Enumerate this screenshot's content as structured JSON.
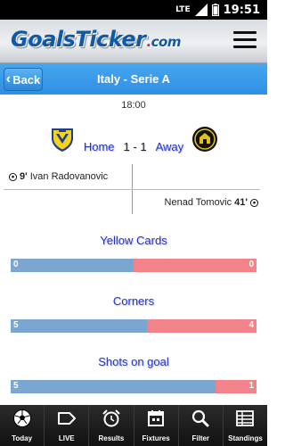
{
  "status_bar": {
    "network": "LTE",
    "time": "19:51"
  },
  "header": {
    "logo_goals": "Goals",
    "logo_ticker": "Ticker",
    "logo_dot": ".",
    "logo_com": "com",
    "menu_icon": "hamburger-menu-icon"
  },
  "nav": {
    "back_label": "Back",
    "title": "Italy - Serie A"
  },
  "match": {
    "kickoff_time": "18:00",
    "home_label": "Home",
    "score": "1 - 1",
    "away_label": "Away"
  },
  "events": [
    {
      "side": "home",
      "minute": "9'",
      "player": "Ivan Radovanovic"
    },
    {
      "side": "away",
      "minute": "41'",
      "player": "Nenad Tomovic"
    }
  ],
  "stats": [
    {
      "title": "Yellow Cards",
      "home": "0",
      "away": "0",
      "home_share": 0.5
    },
    {
      "title": "Corners",
      "home": "5",
      "away": "4",
      "home_share": 0.555
    },
    {
      "title": "Shots on goal",
      "home": "5",
      "away": "1",
      "home_share": 0.833
    }
  ],
  "tabs": [
    {
      "label": "Today",
      "icon": "soccer-ball-icon"
    },
    {
      "label": "LIVE",
      "icon": "tag-icon"
    },
    {
      "label": "Results",
      "icon": "alarm-clock-icon"
    },
    {
      "label": "Fixtures",
      "icon": "calendar-icon"
    },
    {
      "label": "Filter",
      "icon": "search-icon"
    },
    {
      "label": "Standings",
      "icon": "table-grid-icon"
    }
  ],
  "colors": {
    "nav_blue": "#2f8fe3",
    "stat_title_blue": "#2432c9",
    "home_bar": "#7aa6d1",
    "away_bar": "#f3838a"
  }
}
